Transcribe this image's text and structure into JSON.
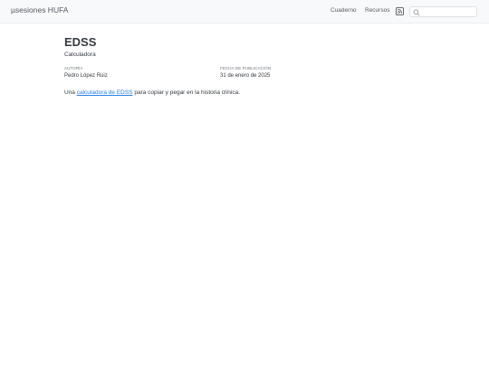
{
  "navbar": {
    "brand": "µsesiones HUFA",
    "links": [
      "Cuaderno",
      "Recursos"
    ],
    "rss_icon": "rss-icon",
    "search": {
      "value": "",
      "placeholder": "",
      "icon": "search-icon"
    }
  },
  "article": {
    "title": "EDSS",
    "subtitle": "Calculadora",
    "author_heading": "Autoría",
    "author": "Pedro López Ruiz",
    "date_heading": "Fecha de publicación",
    "date": "31 de enero de 2025",
    "body": {
      "prefix": "Una ",
      "link_text": "calculadora de EDSS",
      "suffix": " para copiar y pegar en la historia clínica."
    }
  },
  "colors": {
    "navbar_bg": "#f8f9fa",
    "link": "#2780e3",
    "text": "#343a40",
    "muted": "#6c757d"
  }
}
